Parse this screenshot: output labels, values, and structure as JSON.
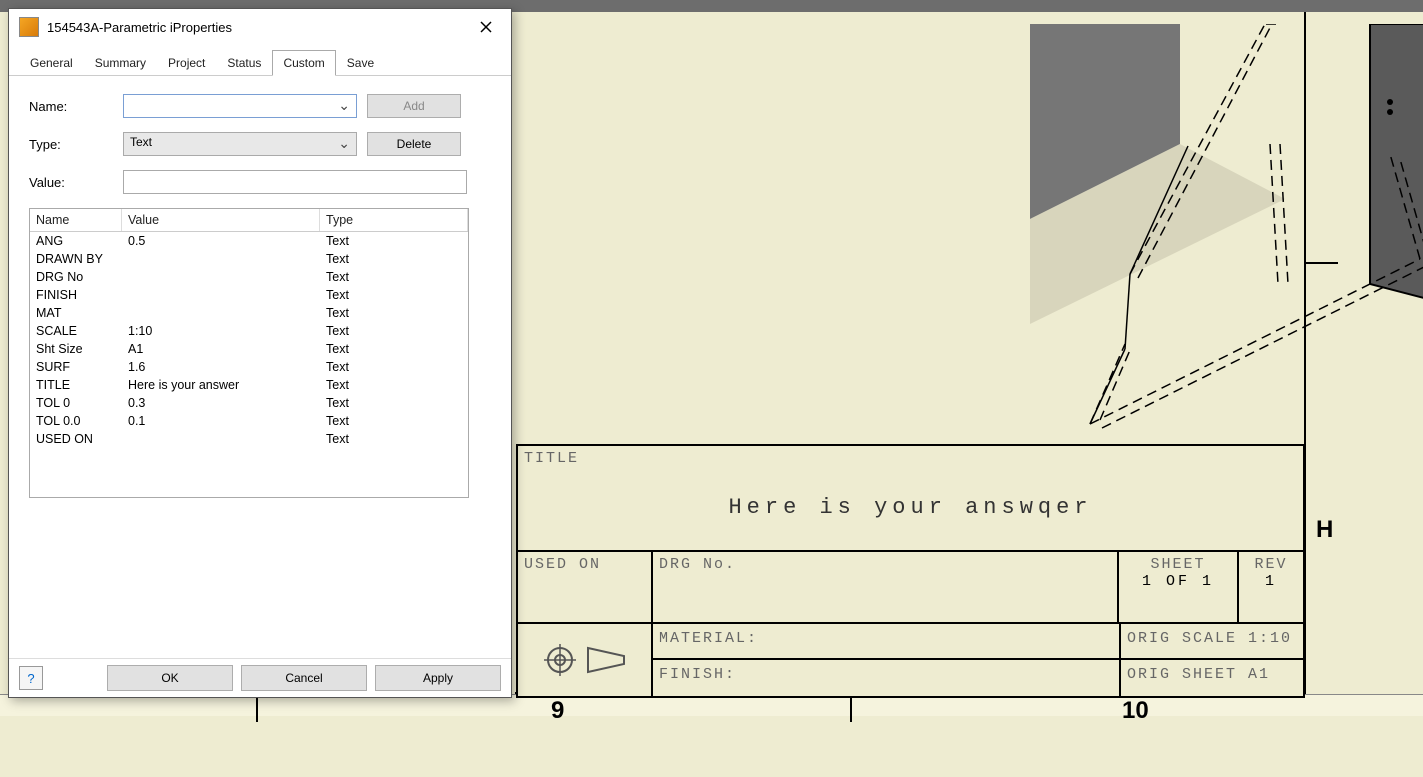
{
  "dialog": {
    "title": "154543A-Parametric iProperties",
    "tabs": [
      "General",
      "Summary",
      "Project",
      "Status",
      "Custom",
      "Save"
    ],
    "active_tab": "Custom",
    "form": {
      "name_label": "Name:",
      "name_value": "",
      "type_label": "Type:",
      "type_value": "Text",
      "value_label": "Value:",
      "value_value": "",
      "add_btn": "Add",
      "delete_btn": "Delete"
    },
    "table": {
      "headers": {
        "name": "Name",
        "value": "Value",
        "type": "Type"
      },
      "rows": [
        {
          "name": "ANG",
          "value": "0.5",
          "type": "Text"
        },
        {
          "name": "DRAWN BY",
          "value": "",
          "type": "Text"
        },
        {
          "name": "DRG No",
          "value": "",
          "type": "Text"
        },
        {
          "name": "FINISH",
          "value": "",
          "type": "Text"
        },
        {
          "name": "MAT",
          "value": "",
          "type": "Text"
        },
        {
          "name": "SCALE",
          "value": "1:10",
          "type": "Text"
        },
        {
          "name": "Sht Size",
          "value": "A1",
          "type": "Text"
        },
        {
          "name": "SURF",
          "value": "1.6",
          "type": "Text"
        },
        {
          "name": "TITLE",
          "value": "Here is your answer",
          "type": "Text"
        },
        {
          "name": "TOL 0",
          "value": "0.3",
          "type": "Text"
        },
        {
          "name": "TOL 0.0",
          "value": "0.1",
          "type": "Text"
        },
        {
          "name": "USED ON",
          "value": "",
          "type": "Text"
        }
      ]
    },
    "footer": {
      "ok": "OK",
      "cancel": "Cancel",
      "apply": "Apply"
    }
  },
  "titleblock": {
    "title_label": "TITLE",
    "title_value": "Here is your answqer",
    "usedon_label": "USED ON",
    "drgno_label": "DRG No.",
    "sheet_label": "SHEET",
    "sheet_value": "1 OF 1",
    "rev_label": "REV",
    "rev_value": "1",
    "material_label": "MATERIAL:",
    "finish_label": "FINISH:",
    "orig_scale": "ORIG SCALE 1:10",
    "orig_sheet": "ORIG SHEET A1"
  },
  "border": {
    "H": "H",
    "9": "9",
    "10": "10"
  }
}
